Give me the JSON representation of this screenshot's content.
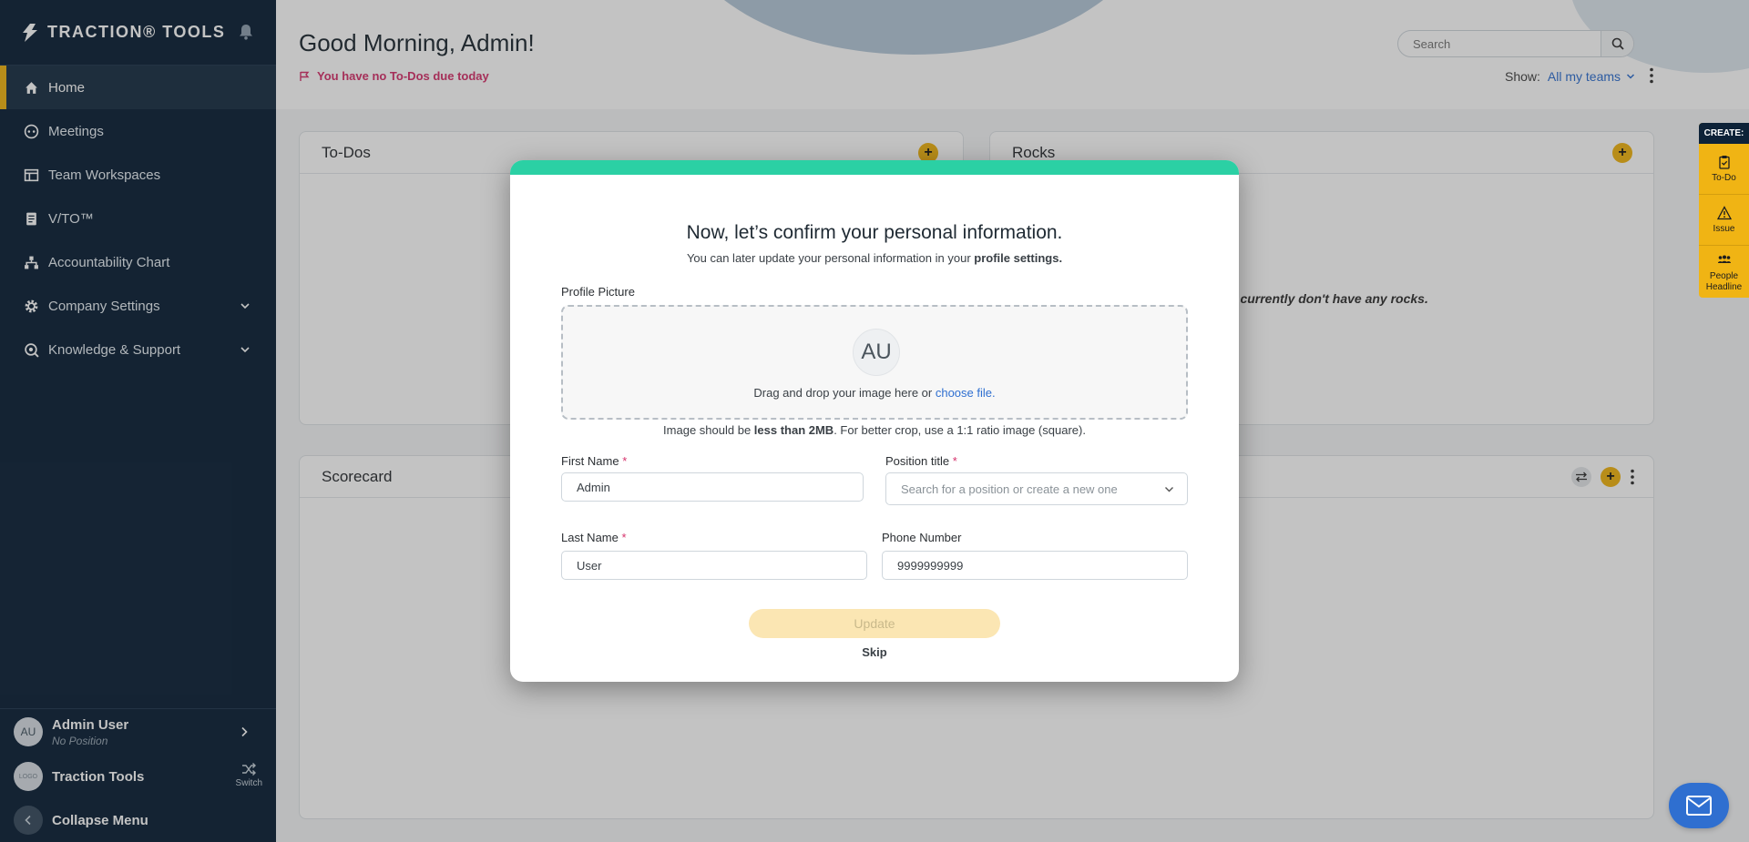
{
  "brand": {
    "name": "TRACTION® TOOLS"
  },
  "sidebar": {
    "items": [
      {
        "label": "Home",
        "icon": "home-icon"
      },
      {
        "label": "Meetings",
        "icon": "meetings-icon"
      },
      {
        "label": "Team Workspaces",
        "icon": "workspace-icon"
      },
      {
        "label": "V/TO™",
        "icon": "vto-icon"
      },
      {
        "label": "Accountability Chart",
        "icon": "org-chart-icon"
      },
      {
        "label": "Company Settings",
        "icon": "gear-icon"
      },
      {
        "label": "Knowledge & Support",
        "icon": "support-icon"
      }
    ],
    "user": {
      "initials": "AU",
      "name": "Admin User",
      "position": "No Position"
    },
    "org": {
      "logo": "LOGO",
      "name": "Traction Tools",
      "switch_label": "Switch"
    },
    "collapse_label": "Collapse Menu"
  },
  "header": {
    "greeting": "Good Morning, Admin!",
    "todo_note": "You have no To-Dos due today",
    "search_placeholder": "Search",
    "show_label": "Show:",
    "show_value": "All my teams"
  },
  "panels": {
    "todos_title": "To-Dos",
    "rocks_title": "Rocks",
    "rocks_empty": "u currently don't have any rocks.",
    "scorecard_title": "Scorecard"
  },
  "create_rail": {
    "title": "CREATE:",
    "items": [
      "To-Do",
      "Issue",
      "People Headline"
    ]
  },
  "modal": {
    "title": "Now, let’s confirm your personal information.",
    "subtitle_prefix": "You can later update your personal information in your ",
    "subtitle_link": "profile settings.",
    "profile_picture_label": "Profile Picture",
    "avatar_initials": "AU",
    "dropzone_text": "Drag and drop your image here or ",
    "dropzone_link": "choose file.",
    "image_note_prefix": "Image should be ",
    "image_note_bold": "less than 2MB",
    "image_note_suffix": ". For better crop, use a 1:1 ratio image (square).",
    "first_name_label": "First Name",
    "first_name_value": "Admin",
    "position_label": "Position title",
    "position_placeholder": "Search for a position or create a new one",
    "last_name_label": "Last Name",
    "last_name_value": "User",
    "phone_label": "Phone Number",
    "phone_value": "9999999999",
    "required_mark": "*",
    "update_label": "Update",
    "skip_label": "Skip"
  },
  "colors": {
    "sidebar_bg": "#0d2238",
    "accent_yellow": "#f0b414",
    "modal_bar": "#2bd0a4",
    "link_blue": "#2f6fd0",
    "alert_pink": "#d6336c"
  }
}
